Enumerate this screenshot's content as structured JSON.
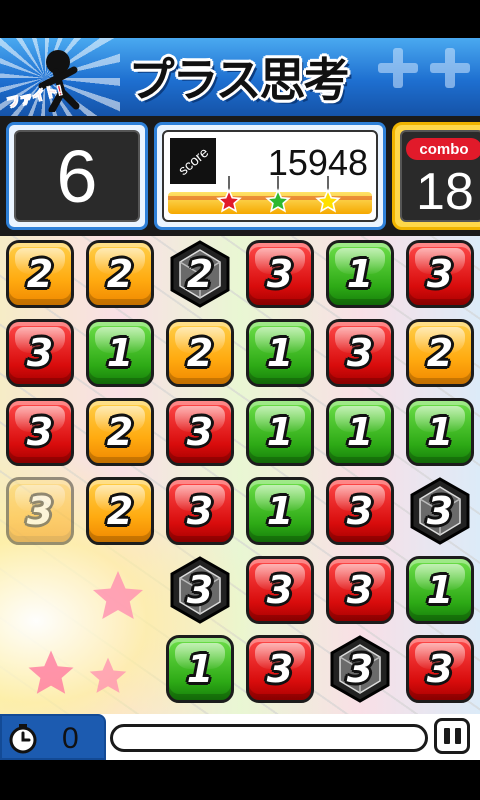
{
  "header": {
    "title": "プラス思考",
    "fight_text": "ファイト!"
  },
  "hud": {
    "moves_left": "6",
    "score_label": "score",
    "score_value": "15948",
    "combo_label": "combo",
    "combo_value": "18",
    "score_progress": 0.98,
    "stars": [
      {
        "name": "red-star",
        "color": "#e11a2a",
        "threshold": 0.33
      },
      {
        "name": "green-star",
        "color": "#2eb82e",
        "threshold": 0.66
      },
      {
        "name": "yellow-star",
        "color": "#ffe000",
        "threshold": 1.0
      }
    ]
  },
  "board": {
    "rows": 6,
    "cols": 6,
    "tiles": [
      [
        {
          "n": "2",
          "c": "orange"
        },
        {
          "n": "2",
          "c": "orange"
        },
        {
          "n": "2",
          "c": "black"
        },
        {
          "n": "3",
          "c": "red"
        },
        {
          "n": "1",
          "c": "green"
        },
        {
          "n": "3",
          "c": "red"
        }
      ],
      [
        {
          "n": "3",
          "c": "red"
        },
        {
          "n": "1",
          "c": "green"
        },
        {
          "n": "2",
          "c": "orange"
        },
        {
          "n": "1",
          "c": "green"
        },
        {
          "n": "3",
          "c": "red"
        },
        {
          "n": "2",
          "c": "orange"
        }
      ],
      [
        {
          "n": "3",
          "c": "red"
        },
        {
          "n": "2",
          "c": "orange"
        },
        {
          "n": "3",
          "c": "red"
        },
        {
          "n": "1",
          "c": "green"
        },
        {
          "n": "1",
          "c": "green"
        },
        {
          "n": "1",
          "c": "green"
        }
      ],
      [
        {
          "n": "3",
          "c": "orange",
          "faded": true
        },
        {
          "n": "2",
          "c": "orange"
        },
        {
          "n": "3",
          "c": "red"
        },
        {
          "n": "1",
          "c": "green"
        },
        {
          "n": "3",
          "c": "red"
        },
        {
          "n": "3",
          "c": "black"
        }
      ],
      [
        null,
        null,
        {
          "n": "3",
          "c": "black"
        },
        {
          "n": "3",
          "c": "red"
        },
        {
          "n": "3",
          "c": "red"
        },
        {
          "n": "1",
          "c": "green"
        }
      ],
      [
        null,
        null,
        {
          "n": "1",
          "c": "green"
        },
        {
          "n": "3",
          "c": "red"
        },
        {
          "n": "3",
          "c": "black"
        },
        {
          "n": "3",
          "c": "red"
        }
      ]
    ]
  },
  "footer": {
    "timer_value": "0",
    "time_progress": 0.0
  },
  "colors": {
    "accent_blue": "#2e80d8",
    "combo_red": "#e11a2a"
  },
  "icons": {
    "clock": "clock-icon",
    "pause": "pause-icon"
  }
}
